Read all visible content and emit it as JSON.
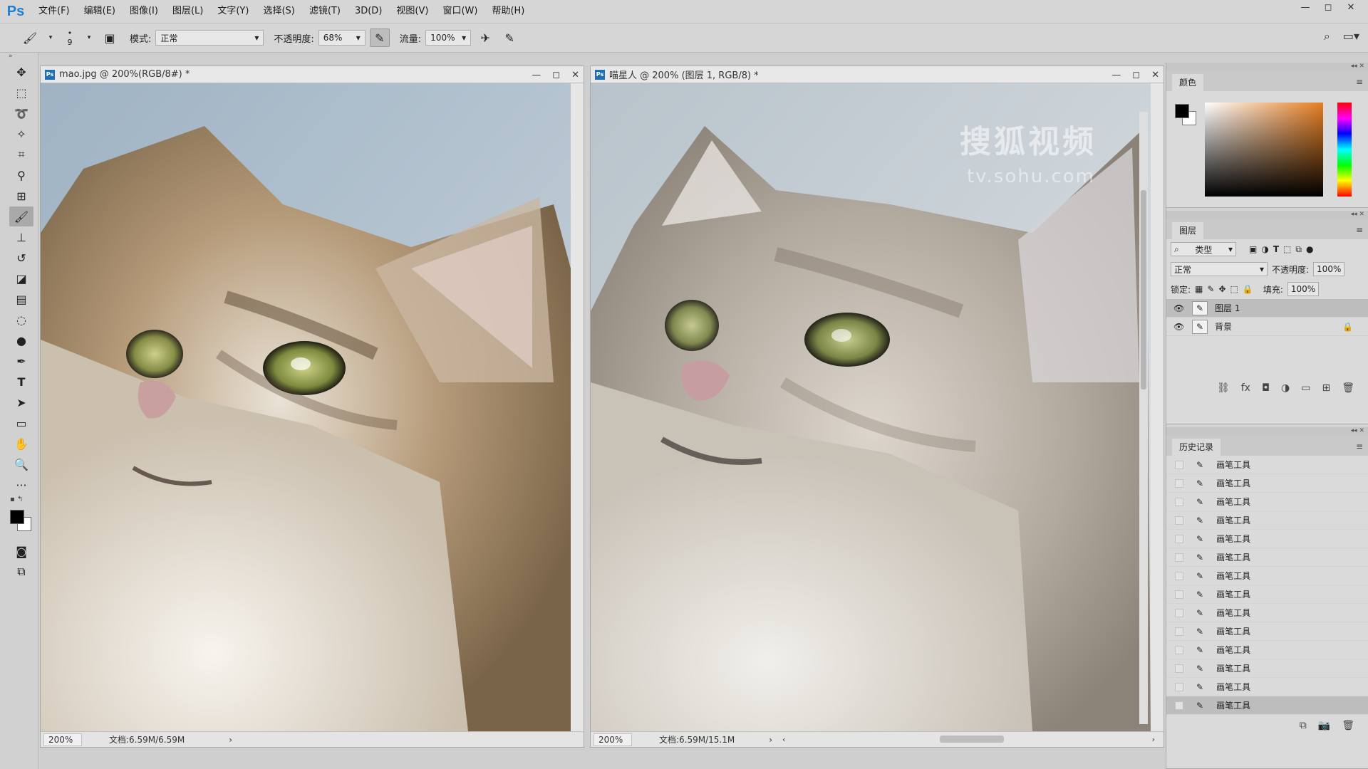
{
  "app": {
    "logo": "Ps"
  },
  "menu": [
    "文件(F)",
    "编辑(E)",
    "图像(I)",
    "图层(L)",
    "文字(Y)",
    "选择(S)",
    "滤镜(T)",
    "3D(D)",
    "视图(V)",
    "窗口(W)",
    "帮助(H)"
  ],
  "options": {
    "brush_size": "9",
    "mode_label": "模式:",
    "mode_value": "正常",
    "opacity_label": "不透明度:",
    "opacity_value": "68%",
    "flow_label": "流量:",
    "flow_value": "100%"
  },
  "watermark": {
    "line1": "搜狐视频",
    "line2": "tv.sohu.com"
  },
  "doc_left": {
    "title": "mao.jpg @ 200%(RGB/8#) *",
    "zoom": "200%",
    "doc_size": "文档:6.59M/6.59M"
  },
  "doc_right": {
    "title": "喵星人 @ 200% (图层 1, RGB/8) *",
    "zoom": "200%",
    "doc_size": "文档:6.59M/15.1M"
  },
  "color_panel": {
    "tab": "颜色"
  },
  "layers_panel": {
    "tab": "图层",
    "filter": "类型",
    "blend_mode": "正常",
    "opacity_label": "不透明度:",
    "opacity_value": "100%",
    "lock_label": "锁定:",
    "fill_label": "填充:",
    "fill_value": "100%",
    "layers": [
      {
        "name": "图层 1",
        "selected": true
      },
      {
        "name": "背景",
        "selected": false,
        "locked": true
      }
    ]
  },
  "history_panel": {
    "tab": "历史记录",
    "items": [
      "画笔工具",
      "画笔工具",
      "画笔工具",
      "画笔工具",
      "画笔工具",
      "画笔工具",
      "画笔工具",
      "画笔工具",
      "画笔工具",
      "画笔工具",
      "画笔工具",
      "画笔工具",
      "画笔工具",
      "画笔工具"
    ]
  },
  "icons": {
    "accent": "#1c7fd6",
    "tools": [
      "move-icon",
      "marquee-icon",
      "lasso-icon",
      "quick-select-icon",
      "crop-icon",
      "eyedropper-icon",
      "healing-icon",
      "brush-icon",
      "stamp-icon",
      "history-brush-icon",
      "eraser-icon",
      "gradient-icon",
      "blur-icon",
      "dodge-icon",
      "pen-icon",
      "type-icon",
      "path-select-icon",
      "rectangle-icon",
      "hand-icon",
      "zoom-icon",
      "more-icon"
    ]
  }
}
